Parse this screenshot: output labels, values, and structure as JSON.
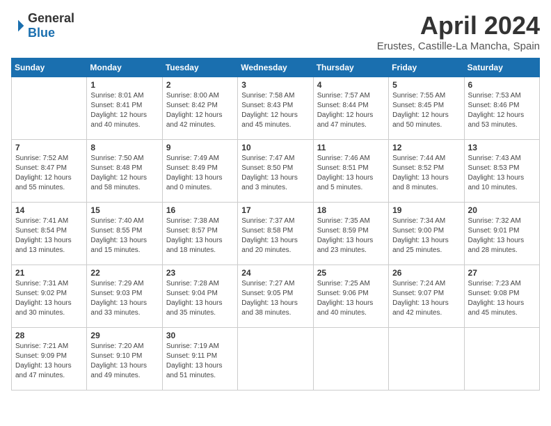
{
  "logo": {
    "general": "General",
    "blue": "Blue"
  },
  "title": "April 2024",
  "subtitle": "Erustes, Castille-La Mancha, Spain",
  "weekdays": [
    "Sunday",
    "Monday",
    "Tuesday",
    "Wednesday",
    "Thursday",
    "Friday",
    "Saturday"
  ],
  "weeks": [
    [
      {
        "day": "",
        "sunrise": "",
        "sunset": "",
        "daylight": ""
      },
      {
        "day": "1",
        "sunrise": "Sunrise: 8:01 AM",
        "sunset": "Sunset: 8:41 PM",
        "daylight": "Daylight: 12 hours and 40 minutes."
      },
      {
        "day": "2",
        "sunrise": "Sunrise: 8:00 AM",
        "sunset": "Sunset: 8:42 PM",
        "daylight": "Daylight: 12 hours and 42 minutes."
      },
      {
        "day": "3",
        "sunrise": "Sunrise: 7:58 AM",
        "sunset": "Sunset: 8:43 PM",
        "daylight": "Daylight: 12 hours and 45 minutes."
      },
      {
        "day": "4",
        "sunrise": "Sunrise: 7:57 AM",
        "sunset": "Sunset: 8:44 PM",
        "daylight": "Daylight: 12 hours and 47 minutes."
      },
      {
        "day": "5",
        "sunrise": "Sunrise: 7:55 AM",
        "sunset": "Sunset: 8:45 PM",
        "daylight": "Daylight: 12 hours and 50 minutes."
      },
      {
        "day": "6",
        "sunrise": "Sunrise: 7:53 AM",
        "sunset": "Sunset: 8:46 PM",
        "daylight": "Daylight: 12 hours and 53 minutes."
      }
    ],
    [
      {
        "day": "7",
        "sunrise": "Sunrise: 7:52 AM",
        "sunset": "Sunset: 8:47 PM",
        "daylight": "Daylight: 12 hours and 55 minutes."
      },
      {
        "day": "8",
        "sunrise": "Sunrise: 7:50 AM",
        "sunset": "Sunset: 8:48 PM",
        "daylight": "Daylight: 12 hours and 58 minutes."
      },
      {
        "day": "9",
        "sunrise": "Sunrise: 7:49 AM",
        "sunset": "Sunset: 8:49 PM",
        "daylight": "Daylight: 13 hours and 0 minutes."
      },
      {
        "day": "10",
        "sunrise": "Sunrise: 7:47 AM",
        "sunset": "Sunset: 8:50 PM",
        "daylight": "Daylight: 13 hours and 3 minutes."
      },
      {
        "day": "11",
        "sunrise": "Sunrise: 7:46 AM",
        "sunset": "Sunset: 8:51 PM",
        "daylight": "Daylight: 13 hours and 5 minutes."
      },
      {
        "day": "12",
        "sunrise": "Sunrise: 7:44 AM",
        "sunset": "Sunset: 8:52 PM",
        "daylight": "Daylight: 13 hours and 8 minutes."
      },
      {
        "day": "13",
        "sunrise": "Sunrise: 7:43 AM",
        "sunset": "Sunset: 8:53 PM",
        "daylight": "Daylight: 13 hours and 10 minutes."
      }
    ],
    [
      {
        "day": "14",
        "sunrise": "Sunrise: 7:41 AM",
        "sunset": "Sunset: 8:54 PM",
        "daylight": "Daylight: 13 hours and 13 minutes."
      },
      {
        "day": "15",
        "sunrise": "Sunrise: 7:40 AM",
        "sunset": "Sunset: 8:55 PM",
        "daylight": "Daylight: 13 hours and 15 minutes."
      },
      {
        "day": "16",
        "sunrise": "Sunrise: 7:38 AM",
        "sunset": "Sunset: 8:57 PM",
        "daylight": "Daylight: 13 hours and 18 minutes."
      },
      {
        "day": "17",
        "sunrise": "Sunrise: 7:37 AM",
        "sunset": "Sunset: 8:58 PM",
        "daylight": "Daylight: 13 hours and 20 minutes."
      },
      {
        "day": "18",
        "sunrise": "Sunrise: 7:35 AM",
        "sunset": "Sunset: 8:59 PM",
        "daylight": "Daylight: 13 hours and 23 minutes."
      },
      {
        "day": "19",
        "sunrise": "Sunrise: 7:34 AM",
        "sunset": "Sunset: 9:00 PM",
        "daylight": "Daylight: 13 hours and 25 minutes."
      },
      {
        "day": "20",
        "sunrise": "Sunrise: 7:32 AM",
        "sunset": "Sunset: 9:01 PM",
        "daylight": "Daylight: 13 hours and 28 minutes."
      }
    ],
    [
      {
        "day": "21",
        "sunrise": "Sunrise: 7:31 AM",
        "sunset": "Sunset: 9:02 PM",
        "daylight": "Daylight: 13 hours and 30 minutes."
      },
      {
        "day": "22",
        "sunrise": "Sunrise: 7:29 AM",
        "sunset": "Sunset: 9:03 PM",
        "daylight": "Daylight: 13 hours and 33 minutes."
      },
      {
        "day": "23",
        "sunrise": "Sunrise: 7:28 AM",
        "sunset": "Sunset: 9:04 PM",
        "daylight": "Daylight: 13 hours and 35 minutes."
      },
      {
        "day": "24",
        "sunrise": "Sunrise: 7:27 AM",
        "sunset": "Sunset: 9:05 PM",
        "daylight": "Daylight: 13 hours and 38 minutes."
      },
      {
        "day": "25",
        "sunrise": "Sunrise: 7:25 AM",
        "sunset": "Sunset: 9:06 PM",
        "daylight": "Daylight: 13 hours and 40 minutes."
      },
      {
        "day": "26",
        "sunrise": "Sunrise: 7:24 AM",
        "sunset": "Sunset: 9:07 PM",
        "daylight": "Daylight: 13 hours and 42 minutes."
      },
      {
        "day": "27",
        "sunrise": "Sunrise: 7:23 AM",
        "sunset": "Sunset: 9:08 PM",
        "daylight": "Daylight: 13 hours and 45 minutes."
      }
    ],
    [
      {
        "day": "28",
        "sunrise": "Sunrise: 7:21 AM",
        "sunset": "Sunset: 9:09 PM",
        "daylight": "Daylight: 13 hours and 47 minutes."
      },
      {
        "day": "29",
        "sunrise": "Sunrise: 7:20 AM",
        "sunset": "Sunset: 9:10 PM",
        "daylight": "Daylight: 13 hours and 49 minutes."
      },
      {
        "day": "30",
        "sunrise": "Sunrise: 7:19 AM",
        "sunset": "Sunset: 9:11 PM",
        "daylight": "Daylight: 13 hours and 51 minutes."
      },
      {
        "day": "",
        "sunrise": "",
        "sunset": "",
        "daylight": ""
      },
      {
        "day": "",
        "sunrise": "",
        "sunset": "",
        "daylight": ""
      },
      {
        "day": "",
        "sunrise": "",
        "sunset": "",
        "daylight": ""
      },
      {
        "day": "",
        "sunrise": "",
        "sunset": "",
        "daylight": ""
      }
    ]
  ]
}
